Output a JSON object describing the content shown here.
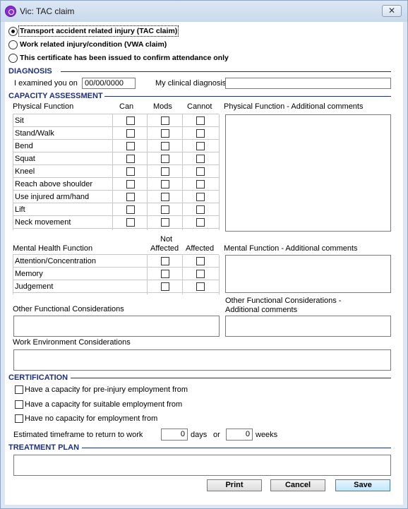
{
  "window": {
    "title": "Vic: TAC claim",
    "close_glyph": "✕"
  },
  "claim_type": {
    "options": [
      {
        "label": "Transport accident related injury (TAC claim)",
        "selected": true
      },
      {
        "label": "Work related injury/condition (VWA claim)",
        "selected": false
      },
      {
        "label": "This certificate has been issued to confirm attendance only",
        "selected": false
      }
    ]
  },
  "diagnosis": {
    "heading": "DIAGNOSIS",
    "examined_label": "I examined you on",
    "examined_value": "00/00/0000",
    "clinical_label": "My clinical diagnosis",
    "clinical_value": ""
  },
  "capacity": {
    "heading": "CAPACITY ASSESSMENT",
    "physical_header": "Physical Function",
    "col_can": "Can",
    "col_mods": "Mods",
    "col_cannot": "Cannot",
    "physical_rows": [
      "Sit",
      "Stand/Walk",
      "Bend",
      "Squat",
      "Kneel",
      "Reach above shoulder",
      "Use injured arm/hand",
      "Lift",
      "Neck movement"
    ],
    "physical_comments_label": "Physical Function - Additional comments",
    "mental_header": "Mental Health Function",
    "col_not_affected_1": "Not",
    "col_not_affected_2": "Affected",
    "col_affected": "Affected",
    "mental_rows": [
      "Attention/Concentration",
      "Memory",
      "Judgement"
    ],
    "mental_comments_label": "Mental Function - Additional comments",
    "other_label": "Other Functional Considerations",
    "other_comments_label_1": "Other Functional Considerations -",
    "other_comments_label_2": "Additional comments",
    "work_env_label": "Work Environment Considerations"
  },
  "certification": {
    "heading": "CERTIFICATION",
    "options": [
      "Have a capacity for pre-injury employment from",
      "Have a capacity for suitable employment from",
      "Have no capacity for employment from"
    ],
    "timeframe_label": "Estimated timeframe to return to work",
    "days_value": "0",
    "days_label": "days",
    "or_label": "or",
    "weeks_value": "0",
    "weeks_label": "weeks"
  },
  "treatment": {
    "heading": "TREATMENT PLAN",
    "value": ""
  },
  "buttons": {
    "print": "Print",
    "cancel": "Cancel",
    "save": "Save"
  }
}
